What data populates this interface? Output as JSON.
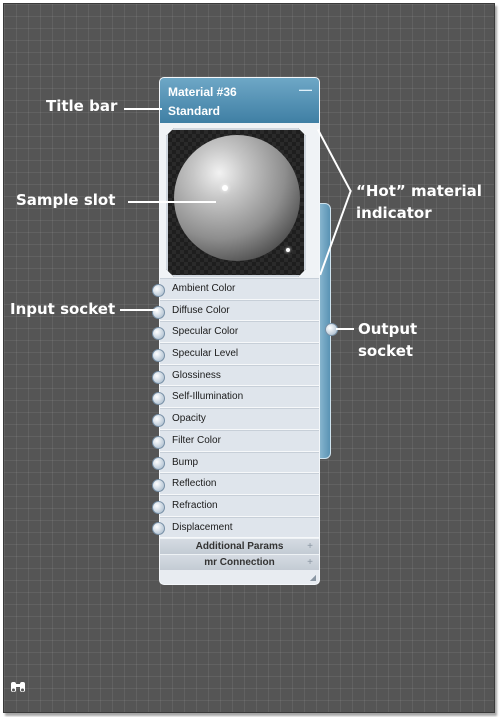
{
  "node": {
    "title_line1": "Material #36",
    "title_line2": "Standard",
    "minimize_label": "—",
    "slots": [
      "Ambient Color",
      "Diffuse Color",
      "Specular Color",
      "Specular Level",
      "Glossiness",
      "Self-Illumination",
      "Opacity",
      "Filter Color",
      "Bump",
      "Reflection",
      "Refraction",
      "Displacement"
    ],
    "rollouts": [
      "Additional Params",
      "mr Connection"
    ]
  },
  "callouts": {
    "title_bar": "Title bar",
    "sample_slot": "Sample slot",
    "input_socket": "Input socket",
    "hot_indicator_line1": "“Hot” material",
    "hot_indicator_line2": "indicator",
    "output_socket_line1": "Output",
    "output_socket_line2": "socket"
  },
  "icons": {
    "navigator": "binoculars-icon"
  }
}
